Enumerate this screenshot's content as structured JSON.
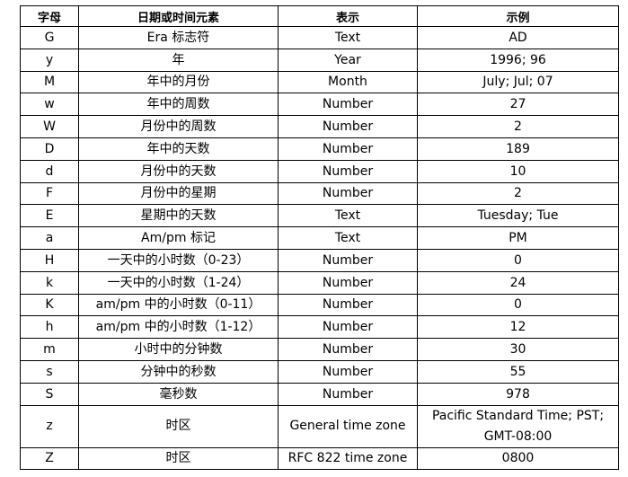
{
  "table": {
    "headers": [
      "字母",
      "日期或时间元素",
      "表示",
      "示例"
    ],
    "rows": [
      {
        "letter": "G",
        "element": "Era 标志符",
        "presentation": "Text",
        "example": [
          "AD"
        ]
      },
      {
        "letter": "y",
        "element": "年",
        "presentation": "Year",
        "example": [
          "1996; 96"
        ]
      },
      {
        "letter": "M",
        "element": "年中的月份",
        "presentation": "Month",
        "example": [
          "July; Jul; 07"
        ]
      },
      {
        "letter": "w",
        "element": "年中的周数",
        "presentation": "Number",
        "example": [
          "27"
        ]
      },
      {
        "letter": "W",
        "element": "月份中的周数",
        "presentation": "Number",
        "example": [
          "2"
        ]
      },
      {
        "letter": "D",
        "element": "年中的天数",
        "presentation": "Number",
        "example": [
          "189"
        ]
      },
      {
        "letter": "d",
        "element": "月份中的天数",
        "presentation": "Number",
        "example": [
          "10"
        ]
      },
      {
        "letter": "F",
        "element": "月份中的星期",
        "presentation": "Number",
        "example": [
          "2"
        ]
      },
      {
        "letter": "E",
        "element": "星期中的天数",
        "presentation": "Text",
        "example": [
          "Tuesday; Tue"
        ]
      },
      {
        "letter": "a",
        "element": "Am/pm 标记",
        "presentation": "Text",
        "example": [
          "PM"
        ]
      },
      {
        "letter": "H",
        "element": "一天中的小时数（0-23）",
        "presentation": "Number",
        "example": [
          "0"
        ]
      },
      {
        "letter": "k",
        "element": "一天中的小时数（1-24）",
        "presentation": "Number",
        "example": [
          "24"
        ]
      },
      {
        "letter": "K",
        "element": "am/pm 中的小时数（0-11）",
        "presentation": "Number",
        "example": [
          "0"
        ]
      },
      {
        "letter": "h",
        "element": "am/pm 中的小时数（1-12）",
        "presentation": "Number",
        "example": [
          "12"
        ]
      },
      {
        "letter": "m",
        "element": "小时中的分钟数",
        "presentation": "Number",
        "example": [
          "30"
        ]
      },
      {
        "letter": "s",
        "element": "分钟中的秒数",
        "presentation": "Number",
        "example": [
          "55"
        ]
      },
      {
        "letter": "S",
        "element": "毫秒数",
        "presentation": "Number",
        "example": [
          "978"
        ]
      },
      {
        "letter": "z",
        "element": "时区",
        "presentation": "General time zone",
        "example": [
          "Pacific Standard Time; PST;",
          "GMT-08:00"
        ]
      },
      {
        "letter": "Z",
        "element": "时区",
        "presentation": "RFC 822 time zone",
        "example": [
          "0800"
        ]
      }
    ]
  }
}
